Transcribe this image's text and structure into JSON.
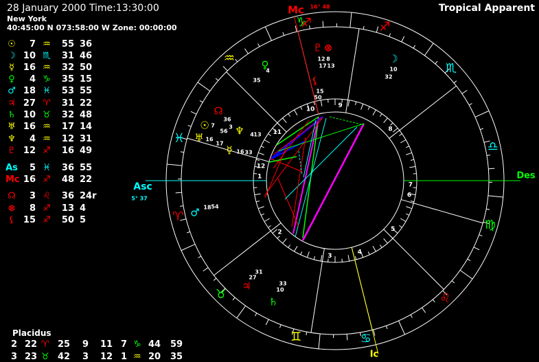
{
  "header": {
    "datetime": "28 January 2000  Time:13:30:00",
    "place": "New York",
    "coords": "40:45:00 N 073:58:00 W  Zone: 00:00:00",
    "zodiac": "Tropical Apparent"
  },
  "colors": {
    "yellow": "#ffff00",
    "cyan": "#00ffff",
    "green": "#00ff00",
    "red": "#ff0000",
    "magenta": "#ff00ff",
    "white": "#ffffff"
  },
  "planets": [
    {
      "sym": "☉",
      "color": "#ffff00",
      "deg": "7",
      "sign": "♒",
      "sign_color": "#ffff00",
      "min": "55",
      "sec": "36"
    },
    {
      "sym": "☽",
      "color": "#00ffff",
      "deg": "10",
      "sign": "♏",
      "sign_color": "#00ffff",
      "min": "31",
      "sec": "46"
    },
    {
      "sym": "☿",
      "color": "#ffff00",
      "deg": "16",
      "sign": "♒",
      "sign_color": "#ffff00",
      "min": "32",
      "sec": "50"
    },
    {
      "sym": "♀",
      "color": "#00ff00",
      "deg": "4",
      "sign": "♑",
      "sign_color": "#00ff00",
      "min": "35",
      "sec": "15"
    },
    {
      "sym": "♂",
      "color": "#00ffff",
      "deg": "18",
      "sign": "♓",
      "sign_color": "#00ffff",
      "min": "53",
      "sec": "55"
    },
    {
      "sym": "♃",
      "color": "#ff0000",
      "deg": "27",
      "sign": "♈",
      "sign_color": "#ff0000",
      "min": "31",
      "sec": "22"
    },
    {
      "sym": "♄",
      "color": "#00ff00",
      "deg": "10",
      "sign": "♉",
      "sign_color": "#00ff00",
      "min": "32",
      "sec": "48"
    },
    {
      "sym": "♅",
      "color": "#ffff00",
      "deg": "16",
      "sign": "♒",
      "sign_color": "#ffff00",
      "min": "17",
      "sec": "14"
    },
    {
      "sym": "♆",
      "color": "#ffff00",
      "deg": "4",
      "sign": "♒",
      "sign_color": "#ffff00",
      "min": "12",
      "sec": "31"
    },
    {
      "sym": "♇",
      "color": "#ff0000",
      "deg": "12",
      "sign": "♐",
      "sign_color": "#ff0000",
      "min": "16",
      "sec": "49"
    },
    {
      "sym": "As",
      "color": "#00ffff",
      "deg": "5",
      "sign": "♓",
      "sign_color": "#00ffff",
      "min": "36",
      "sec": "55"
    },
    {
      "sym": "Mc",
      "color": "#ff0000",
      "deg": "16",
      "sign": "♐",
      "sign_color": "#ff0000",
      "min": "48",
      "sec": "22"
    },
    {
      "sym": "☊",
      "color": "#ff0000",
      "deg": "3",
      "sign": "♌",
      "sign_color": "#ff0000",
      "min": "36",
      "sec": "24r"
    },
    {
      "sym": "⊗",
      "color": "#ff0000",
      "deg": "8",
      "sign": "♐",
      "sign_color": "#ff0000",
      "min": "13",
      "sec": "4"
    },
    {
      "sym": "⚸",
      "color": "#ff0000",
      "deg": "15",
      "sign": "♐",
      "sign_color": "#ff0000",
      "min": "50",
      "sec": "5"
    }
  ],
  "houses": {
    "system": "Placidus",
    "rows": [
      {
        "h1": "2",
        "d1": "22",
        "s1": "♈",
        "c1": "#ff0000",
        "m1": "25",
        "h2": "9",
        "d2": "11",
        "h3": "7",
        "s3": "♑",
        "c3": "#00ff00",
        "d3": "44",
        "m3": "59"
      },
      {
        "h1": "3",
        "d1": "23",
        "s1": "♉",
        "c1": "#00ff00",
        "m1": "42",
        "h2": "3",
        "d2": "12",
        "h3": "1",
        "s3": "♒",
        "c3": "#ffff00",
        "d3": "20",
        "m3": "35"
      }
    ]
  },
  "wheel": {
    "angles": {
      "mc": "Mc",
      "mc_deg": "16° 48",
      "asc": "Asc",
      "asc_deg": "5° 37",
      "des": "Des",
      "ic": "Ic"
    },
    "signs": [
      {
        "sym": "♐",
        "color": "#ff0000"
      },
      {
        "sym": "♏",
        "color": "#00ffff"
      },
      {
        "sym": "♎",
        "color": "#00ffff"
      },
      {
        "sym": "♍",
        "color": "#00ff00"
      },
      {
        "sym": "♌",
        "color": "#ff0000"
      },
      {
        "sym": "♋",
        "color": "#00ffff"
      },
      {
        "sym": "♊",
        "color": "#ffff00"
      },
      {
        "sym": "♉",
        "color": "#00ff00"
      },
      {
        "sym": "♈",
        "color": "#ff0000"
      },
      {
        "sym": "♓",
        "color": "#00ffff"
      },
      {
        "sym": "♒",
        "color": "#ffff00"
      },
      {
        "sym": "♑",
        "color": "#00ff00"
      }
    ],
    "house_numbers": [
      "1",
      "2",
      "3",
      "4",
      "5",
      "6",
      "7",
      "8",
      "9",
      "10",
      "11",
      "12"
    ],
    "chart_planets": [
      {
        "name": "pluto",
        "sym": "♇",
        "color": "#ff0000",
        "d1": "12",
        "d2": "17",
        "d3": ""
      },
      {
        "name": "fortune",
        "sym": "⊗",
        "color": "#ff0000",
        "d1": "8",
        "d2": "13",
        "d3": ""
      },
      {
        "name": "vertex",
        "sym": "⚸",
        "color": "#ff0000",
        "d1": "15",
        "d2": "50",
        "d3": ""
      },
      {
        "name": "moon",
        "sym": "☽",
        "color": "#00ffff",
        "d1": "10",
        "d2": "32",
        "d3": ""
      },
      {
        "name": "venus",
        "sym": "♀",
        "color": "#00ff00",
        "d1": "4",
        "d2": "35",
        "d3": ""
      },
      {
        "name": "node",
        "sym": "☊",
        "color": "#ff0000",
        "d1": "36",
        "d2": "3",
        "d3": ""
      },
      {
        "name": "sun",
        "sym": "☉",
        "color": "#ffff00",
        "d1": "7",
        "d2": "56",
        "d3": ""
      },
      {
        "name": "neptune",
        "sym": "♆",
        "color": "#ffff00",
        "d1": "4",
        "d2": "13",
        "d3": ""
      },
      {
        "name": "uranus",
        "sym": "♅",
        "color": "#ffff00",
        "d1": "16",
        "d2": "17",
        "d3": ""
      },
      {
        "name": "mercury",
        "sym": "☿",
        "color": "#ffff00",
        "d1": "16",
        "d2": "33",
        "d3": ""
      },
      {
        "name": "mars",
        "sym": "♂",
        "color": "#00ffff",
        "d1": "18",
        "d2": "54",
        "d3": ""
      },
      {
        "name": "jupiter",
        "sym": "♃",
        "color": "#ff0000",
        "d1": "27",
        "d2": "31",
        "d3": ""
      },
      {
        "name": "saturn",
        "sym": "♄",
        "color": "#00ff00",
        "d1": "10",
        "d2": "33",
        "d3": ""
      }
    ]
  }
}
